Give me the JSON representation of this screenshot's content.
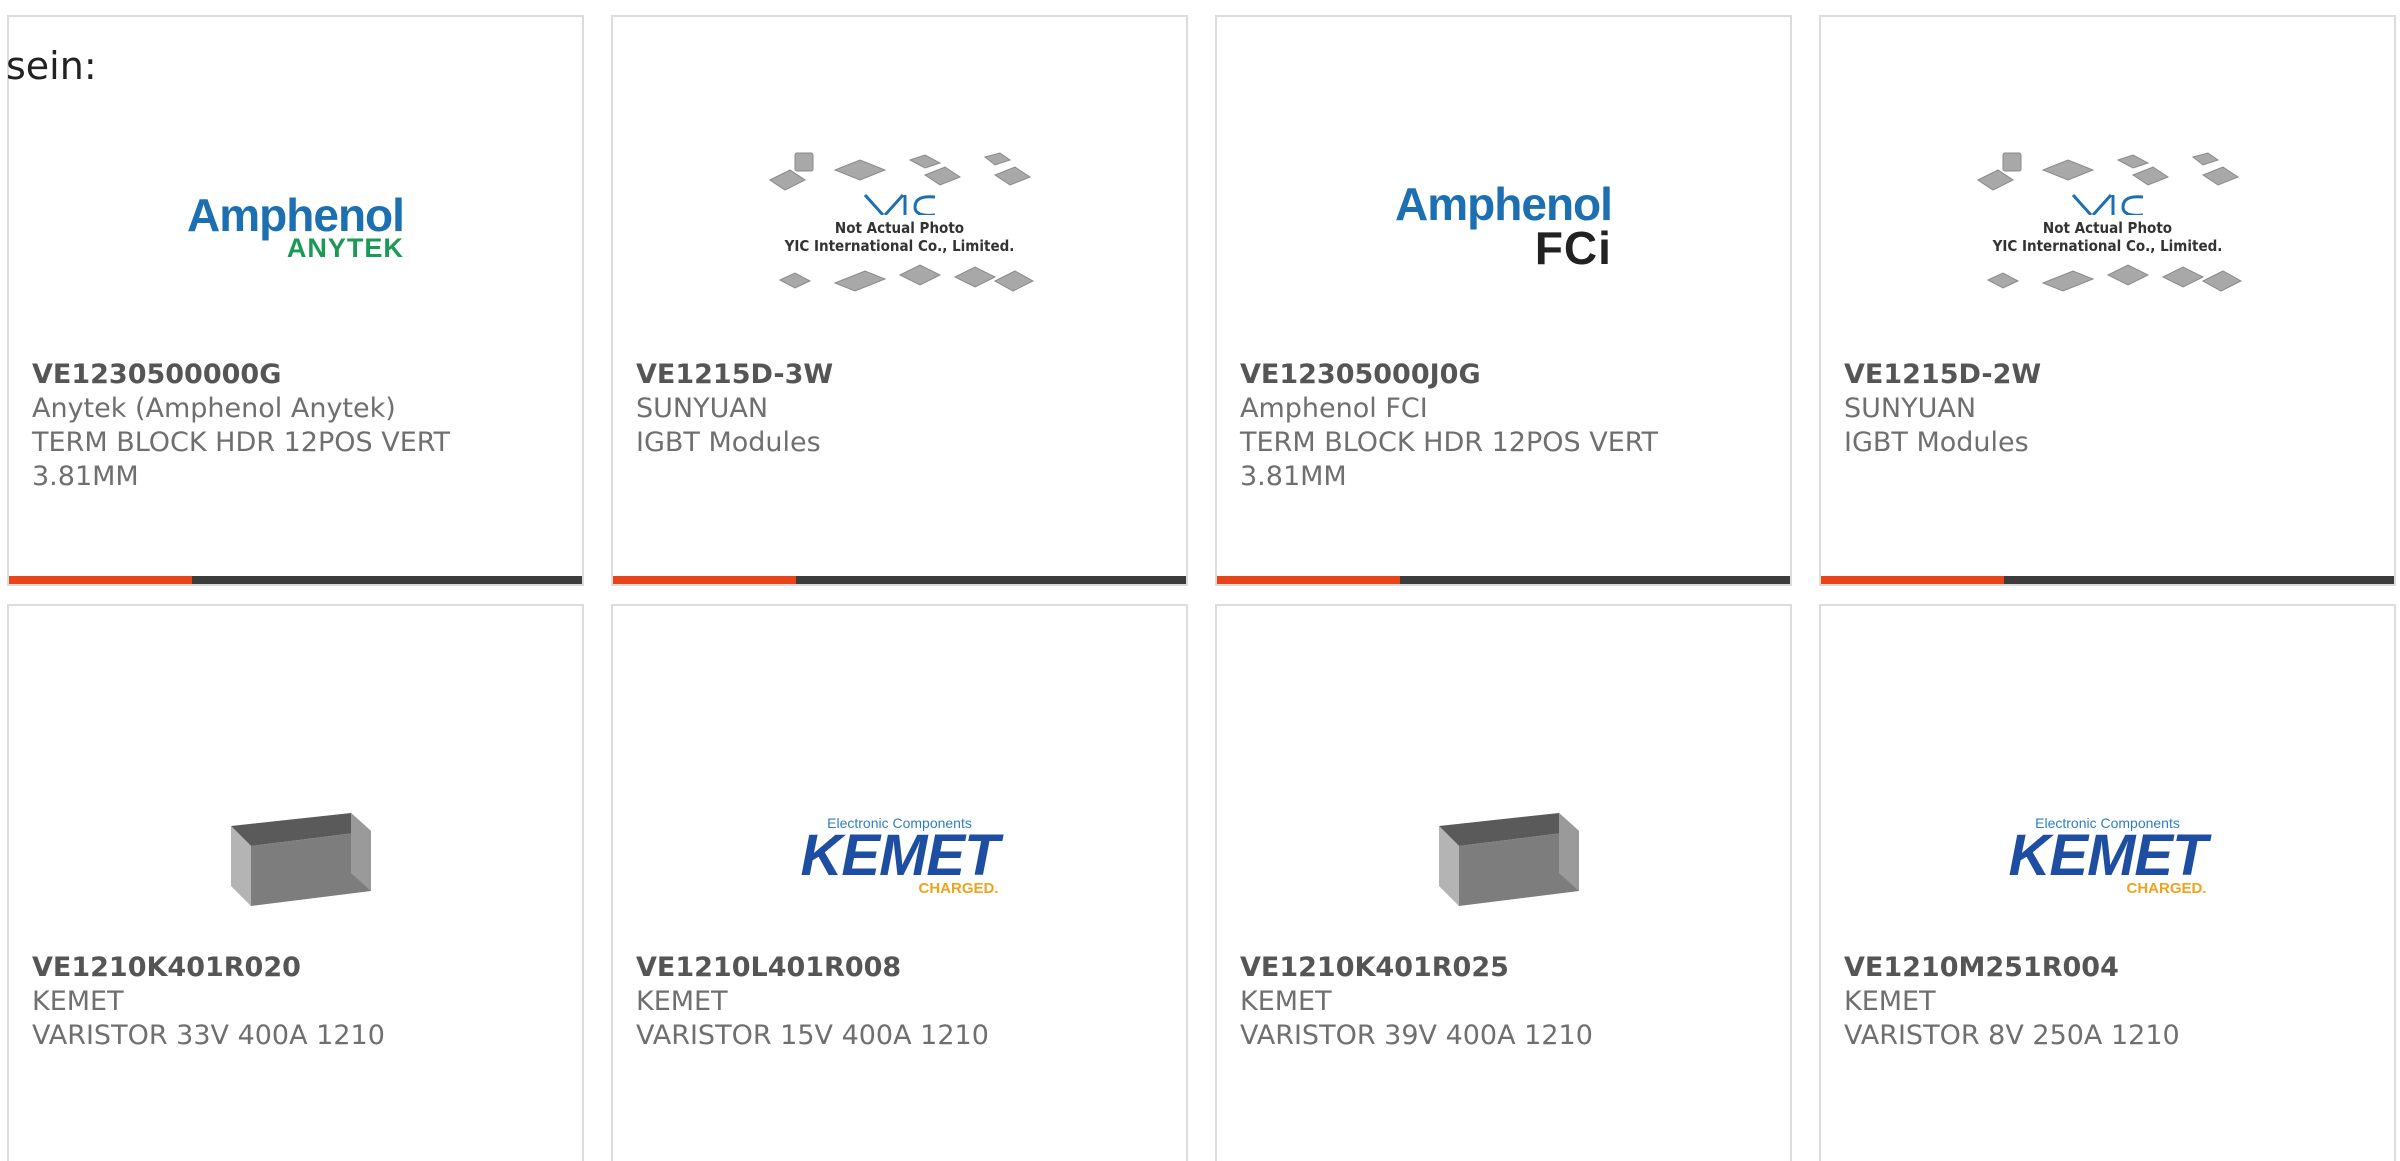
{
  "intro_text": "sein:",
  "colors": {
    "accent": "#e8441a",
    "bar": "#3c3c3c",
    "card_border": "#dcdcdc",
    "text": "#6f6f6f"
  },
  "logos": {
    "amphenol": "Amphenol",
    "anytek": "ANYTEK",
    "fci": "FCi",
    "yic_line1": "Not Actual Photo",
    "yic_line2": "YIC International Co., Limited.",
    "kemet_top": "Electronic Components",
    "kemet_main": "KEMET",
    "kemet_bottom": "CHARGED."
  },
  "products": [
    {
      "part": "VE1230500000G",
      "manufacturer": "Anytek (Amphenol Anytek)",
      "description": "TERM BLOCK HDR 12POS VERT 3.81MM",
      "image": "amphenol-anytek-logo"
    },
    {
      "part": "VE1215D-3W",
      "manufacturer": "SUNYUAN",
      "description": "IGBT Modules",
      "image": "yic-placeholder"
    },
    {
      "part": "VE12305000J0G",
      "manufacturer": "Amphenol FCI",
      "description": "TERM BLOCK HDR 12POS VERT 3.81MM",
      "image": "amphenol-fci-logo"
    },
    {
      "part": "VE1215D-2W",
      "manufacturer": "SUNYUAN",
      "description": "IGBT Modules",
      "image": "yic-placeholder"
    },
    {
      "part": "VE1210K401R020",
      "manufacturer": "KEMET",
      "description": "VARISTOR 33V 400A 1210",
      "image": "chip-component"
    },
    {
      "part": "VE1210L401R008",
      "manufacturer": "KEMET",
      "description": "VARISTOR 15V 400A 1210",
      "image": "kemet-logo"
    },
    {
      "part": "VE1210K401R025",
      "manufacturer": "KEMET",
      "description": "VARISTOR 39V 400A 1210",
      "image": "chip-component"
    },
    {
      "part": "VE1210M251R004",
      "manufacturer": "KEMET",
      "description": "VARISTOR 8V 250A 1210",
      "image": "kemet-logo"
    }
  ]
}
